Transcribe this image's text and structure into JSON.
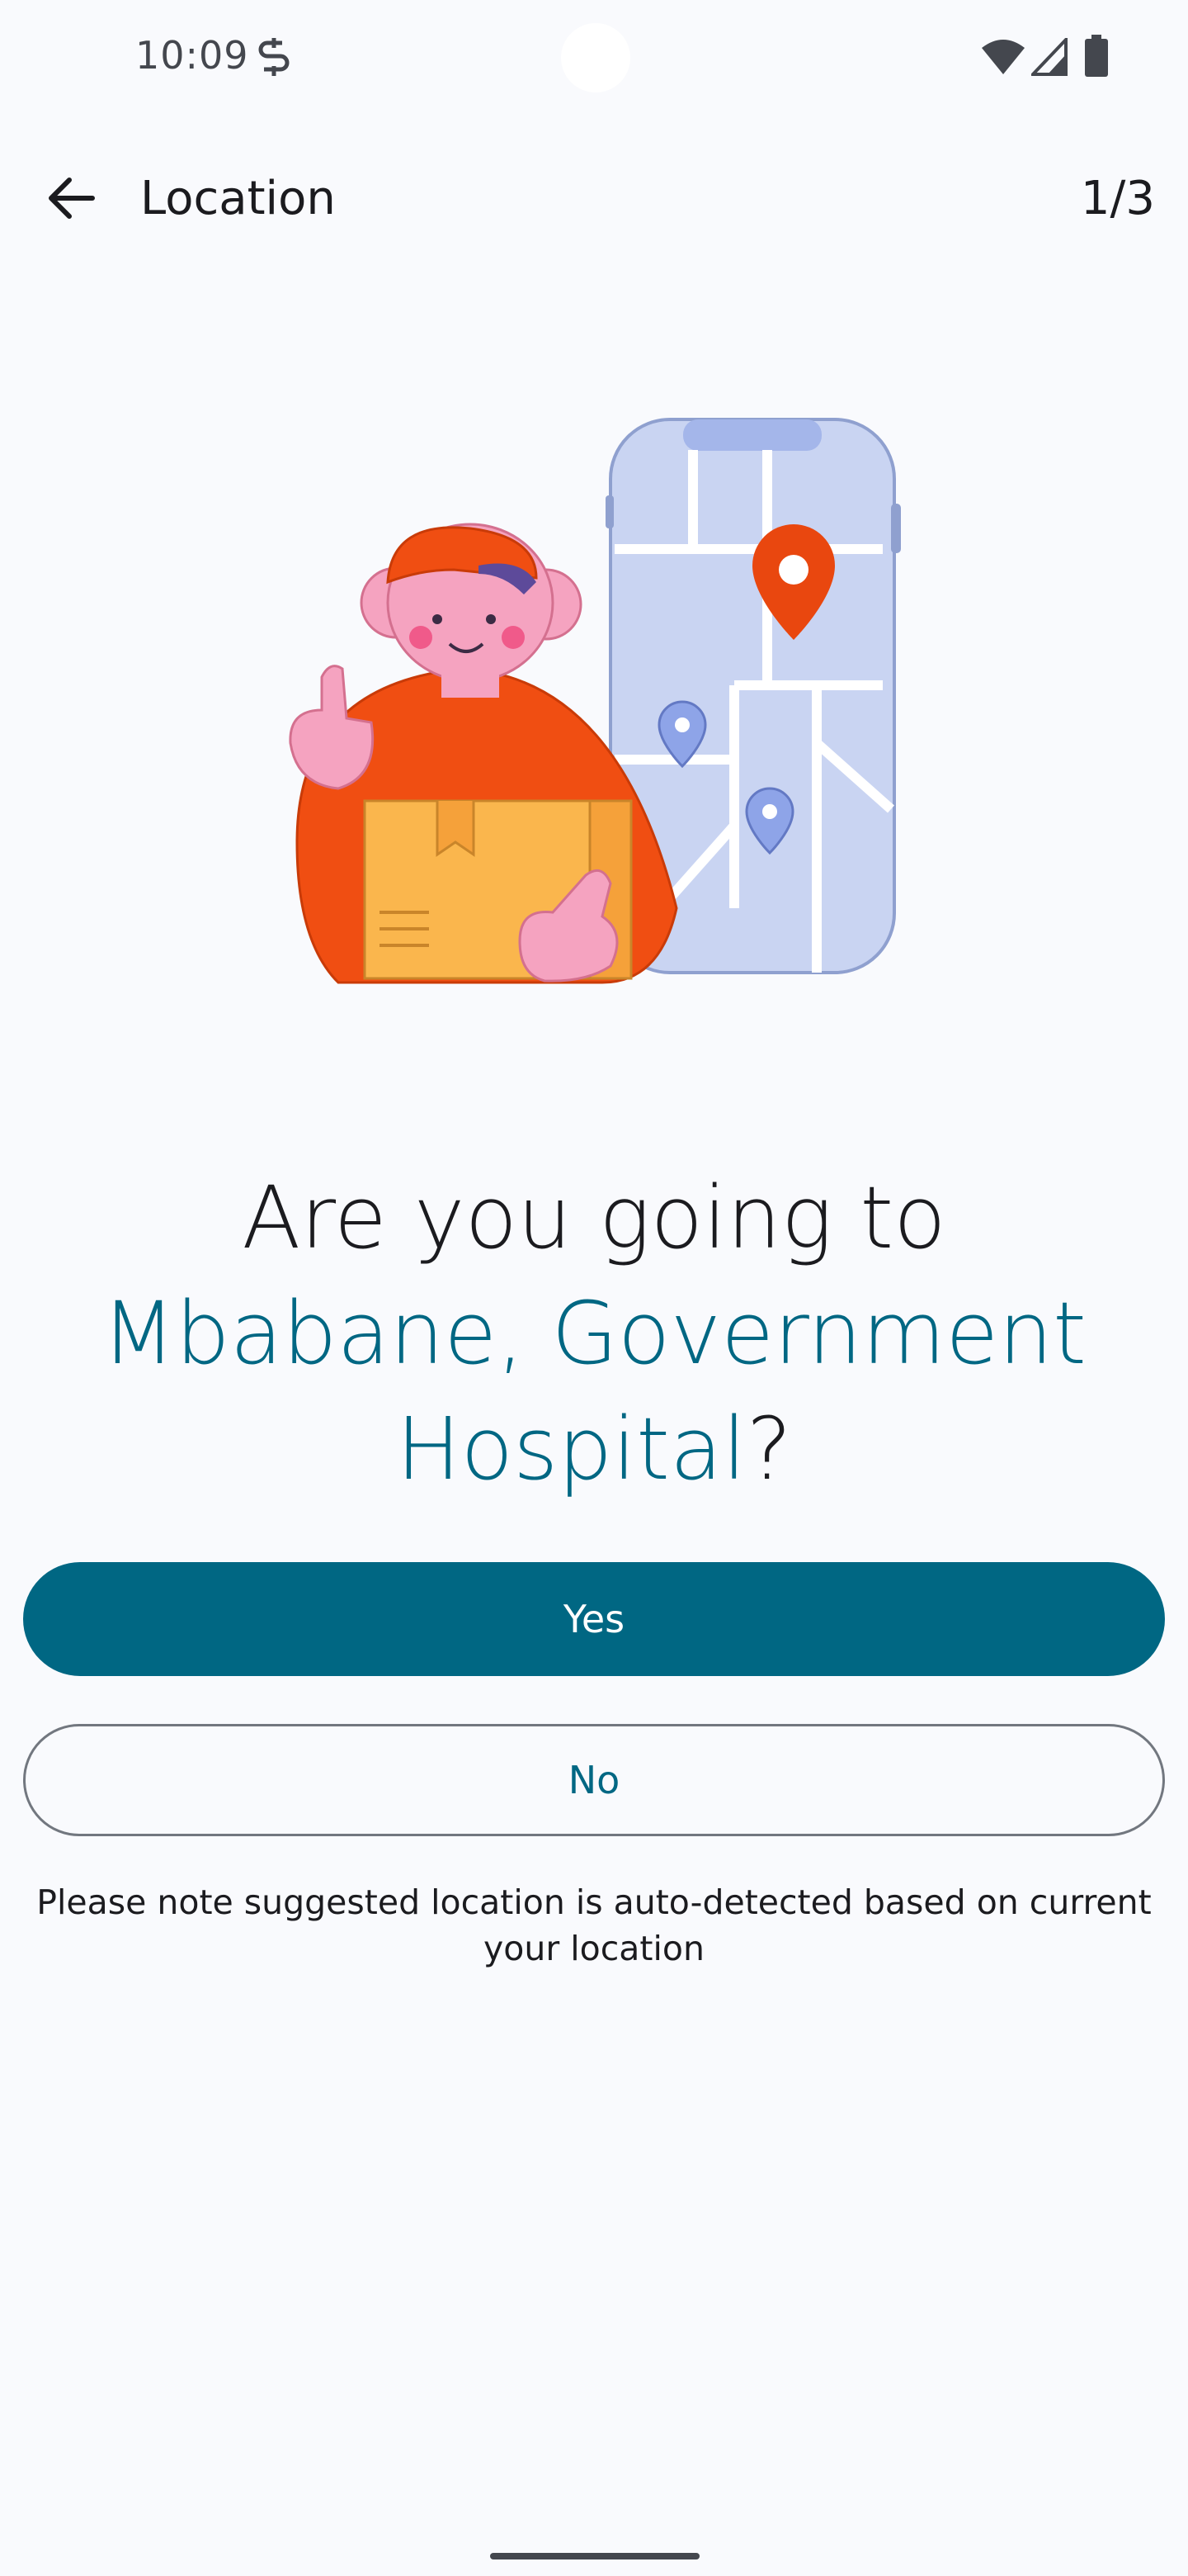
{
  "status_bar": {
    "time": "10:09",
    "icons": [
      "sync-icon",
      "wifi-icon",
      "signal-icon",
      "battery-icon"
    ]
  },
  "top_bar": {
    "back_icon": "arrow-back-icon",
    "title": "Location",
    "step": "1/3"
  },
  "illustration": {
    "description_icon": "delivery-person-map-icon"
  },
  "question": {
    "prefix": "Are you going to",
    "place": "Mbabane, Government Hospital",
    "suffix": "?"
  },
  "actions": {
    "yes_label": "Yes",
    "no_label": "No"
  },
  "note": "Please note suggested location is auto-detected based on current your location",
  "colors": {
    "primary": "#006783",
    "background": "#f9fafd",
    "outline": "#72777f",
    "text": "#1b1b1f",
    "accent_orange": "#f04e12",
    "map_blue": "#c9d4f2"
  }
}
